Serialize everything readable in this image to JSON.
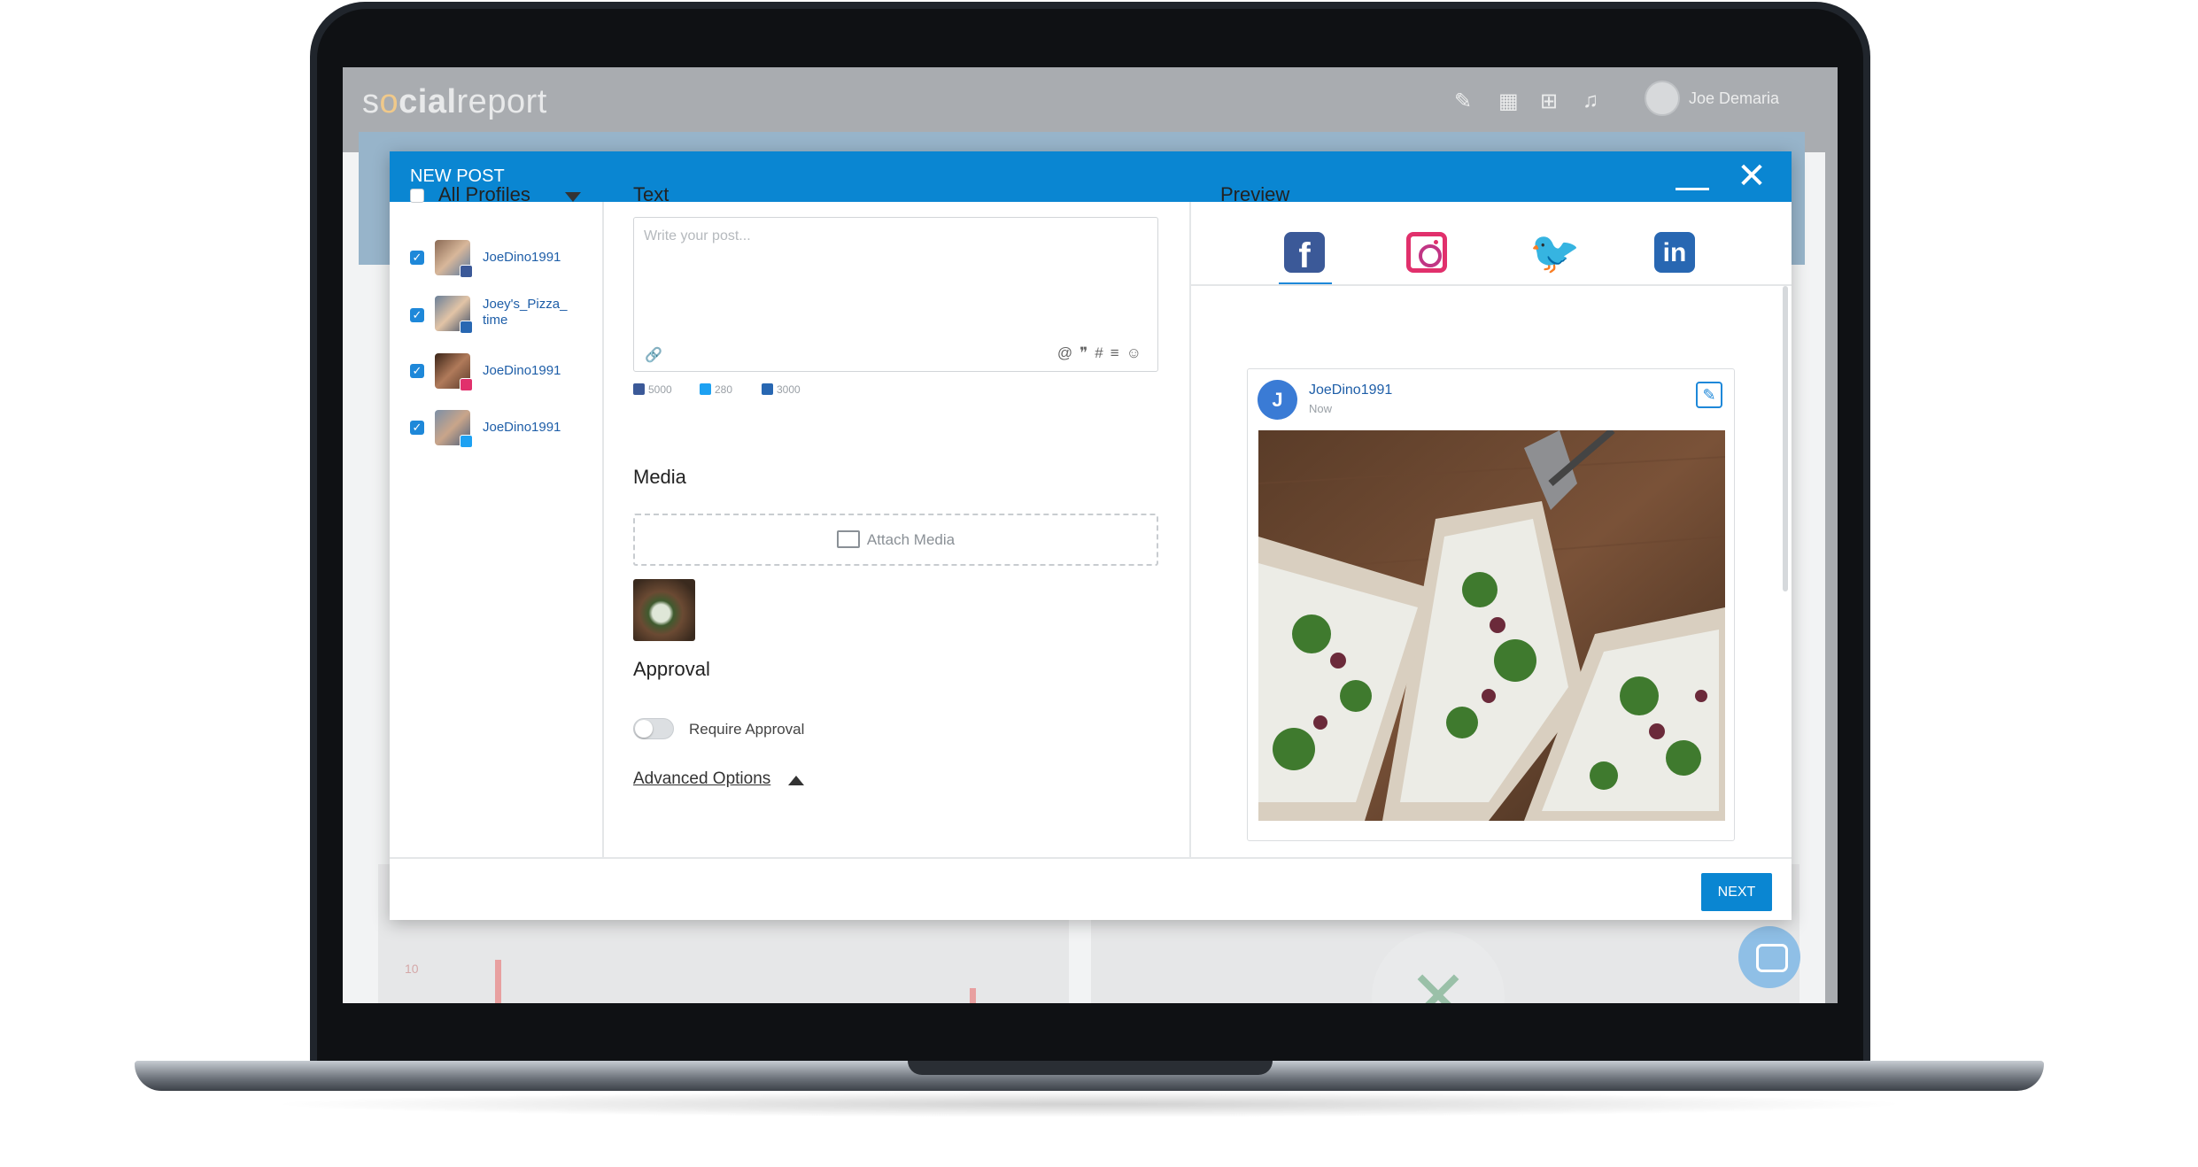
{
  "app": {
    "logo_pre": "s",
    "logo_o": "o",
    "logo_bold": "cial",
    "logo_rest": "report",
    "user_name": "Joe Demaria",
    "header_icons": [
      "edit-icon",
      "calendar-icon",
      "add-icon",
      "bell-icon"
    ]
  },
  "modal": {
    "title": "NEW POST",
    "next_label": "NEXT"
  },
  "profiles": {
    "all_label": "All Profiles",
    "items": [
      {
        "name": "JoeDino1991",
        "network": "facebook",
        "checked": true
      },
      {
        "name": "Joey's_Pizza_\ntime",
        "network": "linkedin",
        "checked": true
      },
      {
        "name": "JoeDino1991",
        "network": "instagram",
        "checked": true
      },
      {
        "name": "JoeDino1991",
        "network": "twitter",
        "checked": true
      }
    ]
  },
  "compose": {
    "text_heading": "Text",
    "placeholder": "Write your post...",
    "counters": {
      "facebook": "5000",
      "twitter": "280",
      "linkedin": "3000"
    },
    "media_heading": "Media",
    "attach_label": "Attach Media",
    "approval_heading": "Approval",
    "require_approval_label": "Require Approval",
    "require_approval_on": false,
    "advanced_options_label": "Advanced Options"
  },
  "preview": {
    "heading": "Preview",
    "tabs": [
      "facebook",
      "instagram",
      "twitter",
      "linkedin"
    ],
    "active_tab": "facebook",
    "card": {
      "avatar_letter": "J",
      "name": "JoeDino1991",
      "time": "Now"
    }
  },
  "background": {
    "axis_value": "10"
  },
  "colors": {
    "accent": "#0a86d2",
    "profile_link": "#1e5ea8",
    "facebook": "#3b5998",
    "twitter": "#1da1f2",
    "linkedin": "#2867b2",
    "instagram": "#e1306c"
  }
}
